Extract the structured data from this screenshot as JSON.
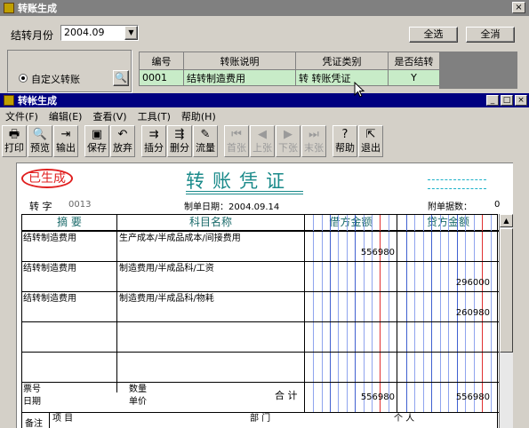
{
  "bg_window": {
    "title": "转账生成",
    "close_label": "×",
    "month_label": "结转月份",
    "month_value": "2004.09",
    "select_all": "全选",
    "deselect": "全消",
    "custom_label": "自定义转账",
    "search_icon": "magnifier-icon",
    "grid": {
      "headers": [
        "编号",
        "转账说明",
        "凭证类别",
        "是否结转"
      ],
      "rows": [
        [
          "0001",
          "结转制造费用",
          "转  转账凭证",
          "Y"
        ]
      ]
    }
  },
  "main_window": {
    "title": "转帐生成",
    "win_buttons": [
      "_",
      "□",
      "×"
    ],
    "menu": [
      "文件(F)",
      "编辑(E)",
      "查看(V)",
      "工具(T)",
      "帮助(H)"
    ],
    "toolbar": [
      {
        "label": "打印",
        "icon": "printer-icon",
        "glyph": "🖶",
        "enabled": true
      },
      {
        "label": "预览",
        "icon": "preview-icon",
        "glyph": "🔍",
        "enabled": true
      },
      {
        "label": "输出",
        "icon": "export-icon",
        "glyph": "⇥",
        "enabled": true
      },
      {
        "label": "保存",
        "icon": "save-icon",
        "glyph": "▣",
        "enabled": true
      },
      {
        "label": "放弃",
        "icon": "undo-icon",
        "glyph": "↶",
        "enabled": true
      },
      {
        "label": "插分",
        "icon": "insert-row-icon",
        "glyph": "⇉",
        "enabled": true
      },
      {
        "label": "删分",
        "icon": "delete-row-icon",
        "glyph": "⇶",
        "enabled": true
      },
      {
        "label": "流量",
        "icon": "flow-icon",
        "glyph": "✎",
        "enabled": true
      },
      {
        "label": "首张",
        "icon": "first-icon",
        "glyph": "⏮",
        "enabled": false
      },
      {
        "label": "上张",
        "icon": "prev-icon",
        "glyph": "◀",
        "enabled": false
      },
      {
        "label": "下张",
        "icon": "next-icon",
        "glyph": "▶",
        "enabled": false
      },
      {
        "label": "末张",
        "icon": "last-icon",
        "glyph": "⏭",
        "enabled": false
      },
      {
        "label": "帮助",
        "icon": "help-icon",
        "glyph": "?",
        "enabled": true
      },
      {
        "label": "退出",
        "icon": "exit-icon",
        "glyph": "⇱",
        "enabled": true
      }
    ]
  },
  "voucher": {
    "stamp": "已生成",
    "title": "转账凭证",
    "type_label": "转 字",
    "number": "0013",
    "date_label": "制单日期：2004.09.14",
    "attach_label": "附单据数：",
    "attach_value": "0",
    "headers": {
      "summary": "摘  要",
      "account": "科目名称",
      "debit": "借方金额",
      "credit": "贷方金额"
    },
    "rows": [
      {
        "summary": "结转制造费用",
        "account": "生产成本/半成品成本/间接费用",
        "debit": "556980",
        "credit": ""
      },
      {
        "summary": "结转制造费用",
        "account": "制造费用/半成品科/工资",
        "debit": "",
        "credit": "296000"
      },
      {
        "summary": "结转制造费用",
        "account": "制造费用/半成品科/物耗",
        "debit": "",
        "credit": "260980"
      },
      {
        "summary": "",
        "account": "",
        "debit": "",
        "credit": ""
      },
      {
        "summary": "",
        "account": "",
        "debit": "",
        "credit": ""
      }
    ],
    "footer": {
      "ticket_label": "票号",
      "date_label": "日期",
      "qty_label": "数量",
      "price_label": "单价",
      "total_label": "合 计",
      "total_debit": "556980",
      "total_credit": "556980",
      "remark_label": "备注",
      "item_label": "项  目",
      "dept_label": "部  门",
      "person_label": "个  人"
    }
  }
}
